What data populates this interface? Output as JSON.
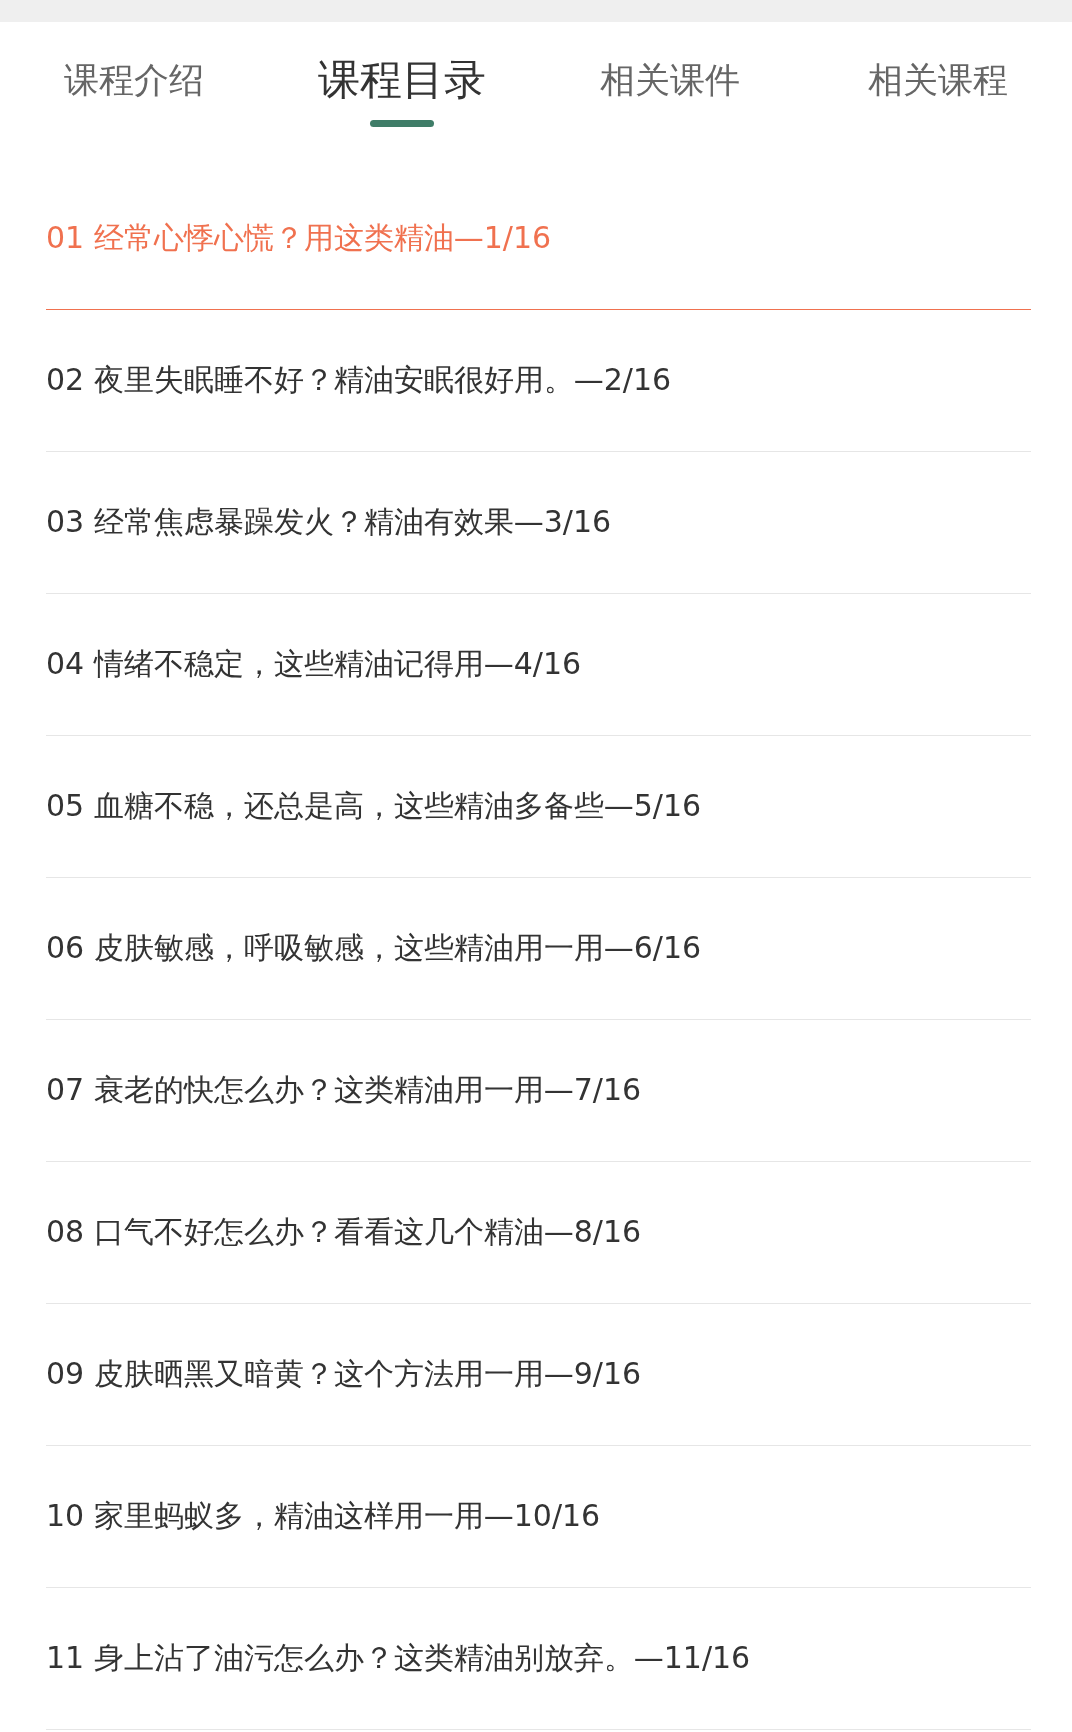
{
  "tabs": [
    {
      "label": "课程介绍",
      "selected": false
    },
    {
      "label": "课程目录",
      "selected": true
    },
    {
      "label": "相关课件",
      "selected": false
    },
    {
      "label": "相关课程",
      "selected": false
    }
  ],
  "lessons": [
    {
      "title": "01 经常心悸心慌？用这类精油—1/16",
      "selected": true
    },
    {
      "title": "02 夜里失眠睡不好？精油安眠很好用。—2/16",
      "selected": false
    },
    {
      "title": "03 经常焦虑暴躁发火？精油有效果—3/16",
      "selected": false
    },
    {
      "title": "04 情绪不稳定，这些精油记得用—4/16",
      "selected": false
    },
    {
      "title": "05 血糖不稳，还总是高，这些精油多备些—5/16",
      "selected": false
    },
    {
      "title": "06 皮肤敏感，呼吸敏感，这些精油用一用—6/16",
      "selected": false
    },
    {
      "title": "07 衰老的快怎么办？这类精油用一用—7/16",
      "selected": false
    },
    {
      "title": "08 口气不好怎么办？看看这几个精油—8/16",
      "selected": false
    },
    {
      "title": "09 皮肤晒黑又暗黄？这个方法用一用—9/16",
      "selected": false
    },
    {
      "title": "10 家里蚂蚁多，精油这样用一用—10/16",
      "selected": false
    },
    {
      "title": "11 身上沾了油污怎么办？这类精油别放弃。—11/16",
      "selected": false
    }
  ]
}
